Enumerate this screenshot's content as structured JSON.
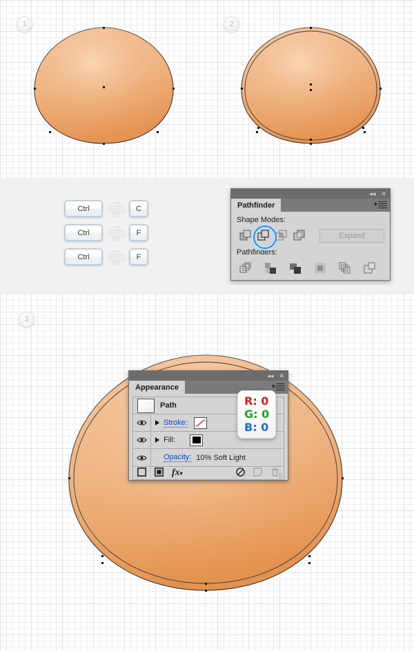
{
  "canvas": {
    "grid_background": "#fdfdfd",
    "grid_line_color": "#e8e8e8",
    "gray_band_color": "#f1f1f1"
  },
  "steps": [
    {
      "number": "1",
      "shape_label": "egg-shape-step-1"
    },
    {
      "number": "2",
      "shape_label": "egg-shape-step-2"
    },
    {
      "number": "3",
      "shape_label": "egg-shape-step-3"
    }
  ],
  "shape_style": {
    "fill_top": "#f3c092",
    "fill_bottom": "#e79a60",
    "stroke": "#2b2b2b"
  },
  "shortcuts": [
    {
      "modifier": "Ctrl",
      "plus": "+",
      "key": "C"
    },
    {
      "modifier": "Ctrl",
      "plus": "+",
      "key": "F"
    },
    {
      "modifier": "Ctrl",
      "plus": "+",
      "key": "F"
    }
  ],
  "pathfinder_panel": {
    "tab_label": "Pathfinder",
    "shape_modes_label": "Shape Modes:",
    "pathfinders_label": "Pathfinders:",
    "expand_label": "Expand",
    "shape_modes": [
      {
        "name": "unite",
        "selected": false
      },
      {
        "name": "minus-front",
        "selected": true
      },
      {
        "name": "intersect",
        "selected": false
      },
      {
        "name": "exclude",
        "selected": false
      }
    ],
    "pathfinders": [
      {
        "name": "divide"
      },
      {
        "name": "trim"
      },
      {
        "name": "merge"
      },
      {
        "name": "crop"
      },
      {
        "name": "outline"
      },
      {
        "name": "minus-back"
      }
    ],
    "collapse_glyph": "◂◂",
    "close_glyph": "✕"
  },
  "appearance_panel": {
    "tab_label": "Appearance",
    "target_label": "Path",
    "rows": [
      {
        "name": "stroke",
        "label": "Stroke:",
        "swatch": "none-diagonal-red"
      },
      {
        "name": "fill",
        "label": "Fill:",
        "swatch": "black"
      }
    ],
    "opacity_label": "Opacity:",
    "opacity_value": "10% Soft Light",
    "footer_icons": [
      "add-new-stroke",
      "add-new-fill",
      "add-new-effect",
      "clear-appearance",
      "duplicate-item",
      "delete-item"
    ],
    "fx_label": "fx",
    "collapse_glyph": "◂◂",
    "close_glyph": "✕"
  },
  "rgb_tooltip": {
    "r_label": "R: 0",
    "g_label": "G: 0",
    "b_label": "B: 0",
    "r_color": "#d81d1d",
    "g_color": "#1aa81a",
    "b_color": "#1b6fd0"
  }
}
